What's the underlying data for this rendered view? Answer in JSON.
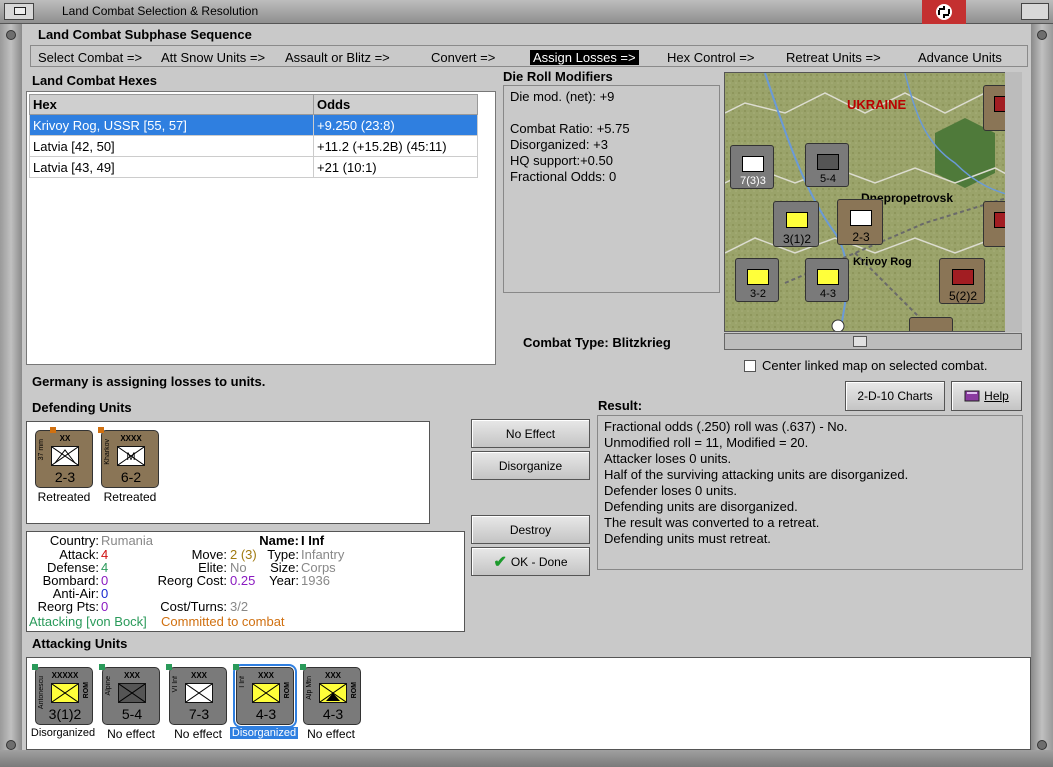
{
  "window": {
    "title": "Land Combat Selection & Resolution"
  },
  "subphase": {
    "title": "Land Combat Subphase Sequence",
    "steps": [
      "Select Combat =>",
      "Att Snow Units =>",
      "Assault or Blitz =>",
      "Convert =>",
      "Assign Losses =>",
      "Hex Control =>",
      "Retreat Units =>",
      "Advance Units"
    ],
    "active_index": 4
  },
  "hexes": {
    "title": "Land Combat Hexes",
    "columns": [
      "Hex",
      "Odds"
    ],
    "rows": [
      {
        "hex": "Krivoy Rog, USSR [55, 57]",
        "odds": "+9.250 (23:8)"
      },
      {
        "hex": "Latvia [42, 50]",
        "odds": "+11.2 (+15.2B) (45:11)"
      },
      {
        "hex": "Latvia [43, 49]",
        "odds": "+21 (10:1)"
      }
    ]
  },
  "die_roll": {
    "title": "Die Roll Modifiers",
    "lines": [
      "Die mod. (net): +9",
      "",
      "Combat Ratio: +5.75",
      "Disorganized: +3",
      "HQ support:+0.50",
      "Fractional Odds: 0"
    ]
  },
  "combat_type": {
    "label": "Combat Type:",
    "value": "Blitzkrieg"
  },
  "map": {
    "region_label": "UKRAINE",
    "city_label": "Dnepropetrovsk",
    "city2_label": "Krivoy Rog"
  },
  "center_map": {
    "label": "Center linked map on selected combat.",
    "checked": false
  },
  "assigning_text": "Germany is assigning losses to units.",
  "buttons": {
    "charts": "2-D-10 Charts",
    "help": "Help",
    "no_effect": "No Effect",
    "disorganize": "Disorganize",
    "destroy": "Destroy",
    "ok": "OK - Done"
  },
  "defending": {
    "title": "Defending Units",
    "units": [
      {
        "size": "XX",
        "side_label": "37 mm",
        "strength": "2-3",
        "status": "Retreated",
        "color": "tan"
      },
      {
        "size": "XXXX",
        "side_label": "Kharkov",
        "strength": "6-2",
        "status": "Retreated",
        "color": "tan"
      }
    ]
  },
  "result": {
    "title": "Result:",
    "lines": [
      "Fractional odds (.250) roll was (.637)  - No.",
      "Unmodified roll = 11, Modified = 20.",
      "Attacker loses 0 units.",
      "Half of the surviving attacking units are disorganized.",
      "Defender loses 0 units.",
      "Defending units are disorganized.",
      "The result was converted to a retreat.",
      "Defending units must retreat."
    ]
  },
  "unit_info": {
    "country_label": "Country:",
    "country": "Rumania",
    "attack_label": "Attack:",
    "attack": "4",
    "defense_label": "Defense:",
    "defense": "4",
    "bombard_label": "Bombard:",
    "bombard": "0",
    "antiair_label": "Anti-Air:",
    "antiair": "0",
    "reorg_pts_label": "Reorg Pts:",
    "reorg_pts": "0",
    "name_label": "Name:",
    "name": "I Inf",
    "move_label": "Move:",
    "move": "2 (3)",
    "elite_label": "Elite:",
    "elite": "No",
    "reorg_cost_label": "Reorg Cost:",
    "reorg_cost": "0.25",
    "cost_turns_label": "Cost/Turns:",
    "cost_turns": "3/2",
    "type_label": "Type:",
    "type": "Infantry",
    "size_label": "Size:",
    "size": "Corps",
    "year_label": "Year:",
    "year": "1936",
    "attacking_under": "Attacking [von Bock]",
    "committed": "Committed to combat"
  },
  "attacking": {
    "title": "Attacking Units",
    "units": [
      {
        "size": "XXXXX",
        "side_label": "Antonescu",
        "strength": "3(1)2",
        "status": "Disorganized",
        "symbol": "yellow"
      },
      {
        "size": "XXX",
        "side_label": "Alpine",
        "strength": "5-4",
        "status": "No effect",
        "symbol": "dark"
      },
      {
        "size": "XXX",
        "side_label": "VI Inf",
        "strength": "7-3",
        "status": "No effect",
        "symbol": "white"
      },
      {
        "size": "XXX",
        "side_label": "I Inf",
        "strength": "4-3",
        "status": "Disorganized",
        "symbol": "yellow",
        "selected": true
      },
      {
        "size": "XXX",
        "side_label": "Alp Mtn",
        "strength": "4-3",
        "status": "No effect",
        "symbol": "yellow"
      }
    ]
  },
  "colors": {
    "selection": "#2f7fe0",
    "attacker_green": "#2a9a5a",
    "committed_orange": "#d07010",
    "red_value": "#d01010",
    "purple_value": "#8a1ac0",
    "gray_value": "#888888"
  }
}
